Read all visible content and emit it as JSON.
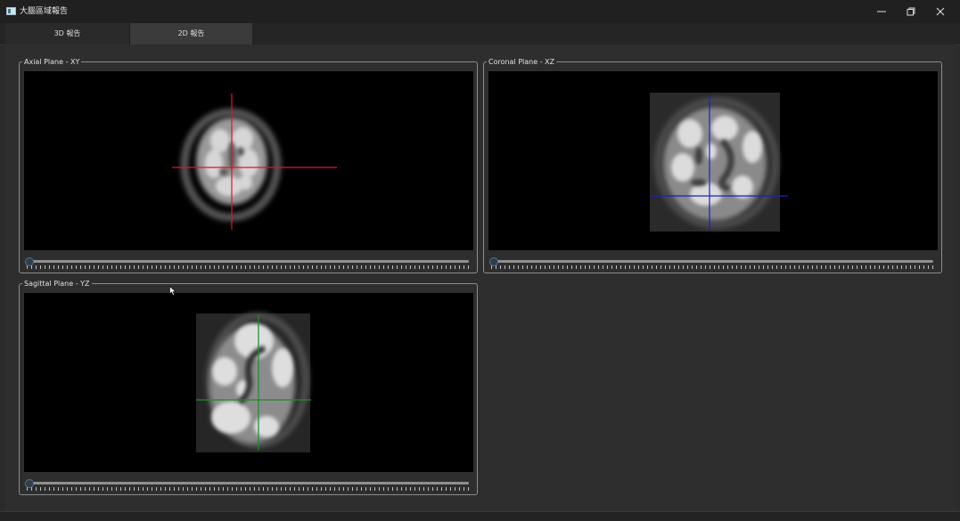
{
  "window": {
    "title": "大腦區域報告",
    "icons": [
      "app-icon",
      "minimize-icon",
      "restore-icon",
      "close-icon"
    ]
  },
  "tabs": [
    {
      "label": "3D 報告",
      "active": false
    },
    {
      "label": "2D 報告",
      "active": true
    }
  ],
  "panels": {
    "axial": {
      "title": "Axial Plane - XY",
      "crosshair_color": "#e0142a",
      "slider_value": 0
    },
    "coronal": {
      "title": "Coronal Plane - XZ",
      "crosshair_color": "#1622c8",
      "slider_value": 0
    },
    "sagittal": {
      "title": "Sagittal Plane - YZ",
      "crosshair_color": "#1e8c2a",
      "slider_value": 0
    }
  }
}
